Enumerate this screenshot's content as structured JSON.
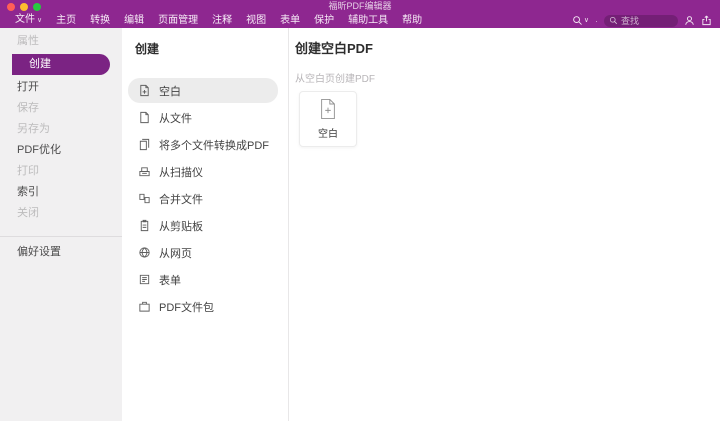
{
  "window": {
    "title": "福昕PDF编辑器"
  },
  "theme": {
    "titlebar_purple": "#8e2790",
    "selected_pill_purple": "#7b2383",
    "selected_list_gray": "#ececec",
    "traffic_red": "#ff5f57",
    "traffic_yellow": "#febc2e",
    "traffic_green": "#28c840"
  },
  "menu": {
    "items": [
      {
        "name": "file",
        "label": "文件",
        "caret": true
      },
      {
        "name": "home",
        "label": "主页"
      },
      {
        "name": "convert",
        "label": "转换"
      },
      {
        "name": "edit",
        "label": "编辑"
      },
      {
        "name": "page-management",
        "label": "页面管理"
      },
      {
        "name": "comment",
        "label": "注释"
      },
      {
        "name": "view",
        "label": "视图"
      },
      {
        "name": "form",
        "label": "表单"
      },
      {
        "name": "protect",
        "label": "保护"
      },
      {
        "name": "accessibility-tools",
        "label": "辅助工具"
      },
      {
        "name": "help",
        "label": "帮助"
      }
    ],
    "search_placeholder": "查找",
    "right_icons": [
      "find-icon",
      "search-icon",
      "account-icon",
      "share-icon"
    ]
  },
  "sidebar": {
    "items": [
      {
        "name": "properties",
        "label": "属性",
        "disabled": true
      },
      {
        "name": "create",
        "label": "创建",
        "selected": true
      },
      {
        "name": "open",
        "label": "打开"
      },
      {
        "name": "save",
        "label": "保存",
        "disabled": true
      },
      {
        "name": "save-as",
        "label": "另存为",
        "disabled": true
      },
      {
        "name": "pdf-optimize",
        "label": "PDF优化"
      },
      {
        "name": "print",
        "label": "打印",
        "disabled": true
      },
      {
        "name": "index",
        "label": "索引"
      },
      {
        "name": "close",
        "label": "关闭",
        "disabled": true
      }
    ],
    "preferences_label": "偏好设置"
  },
  "panel": {
    "title": "创建",
    "items": [
      {
        "name": "blank",
        "label": "空白",
        "icon": "docplus",
        "selected": true
      },
      {
        "name": "from-file",
        "label": "从文件",
        "icon": "doc"
      },
      {
        "name": "convert-multiple-files",
        "label": "将多个文件转换成PDF",
        "icon": "docs"
      },
      {
        "name": "from-scanner",
        "label": "从扫描仪",
        "icon": "scanner"
      },
      {
        "name": "combine-files",
        "label": "合并文件",
        "icon": "merge"
      },
      {
        "name": "from-clipboard",
        "label": "从剪贴板",
        "icon": "clipboard"
      },
      {
        "name": "from-web",
        "label": "从网页",
        "icon": "globe"
      },
      {
        "name": "form",
        "label": "表单",
        "icon": "form"
      },
      {
        "name": "pdf-portfolio",
        "label": "PDF文件包",
        "icon": "package"
      }
    ]
  },
  "content": {
    "title": "创建空白PDF",
    "subtitle": "从空白页创建PDF",
    "card_label": "空白",
    "card_icon": "new-document-icon"
  }
}
